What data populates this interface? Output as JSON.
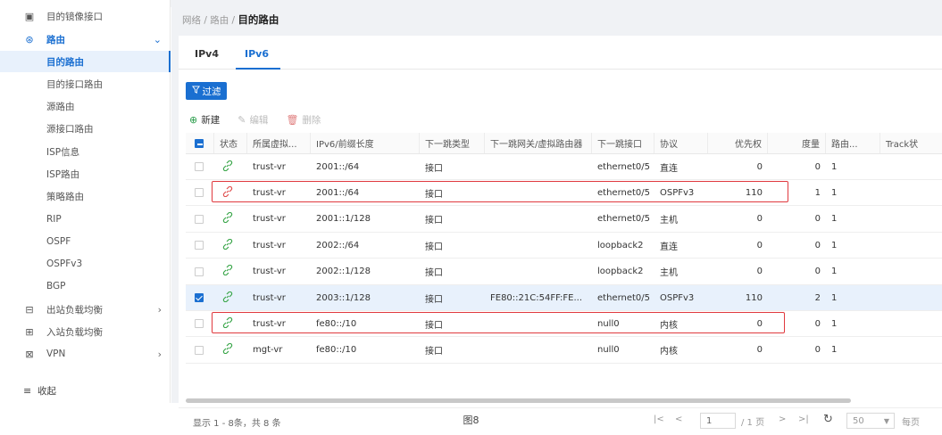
{
  "sidebar": {
    "items": [
      {
        "icon": "mirror-icon",
        "label": "目的镜像接口",
        "type": "top"
      },
      {
        "icon": "route-icon",
        "label": "路由",
        "type": "group",
        "arrow": "chevron-down-icon"
      },
      {
        "label": "目的路由",
        "type": "active"
      },
      {
        "label": "目的接口路由",
        "type": "sub"
      },
      {
        "label": "源路由",
        "type": "sub"
      },
      {
        "label": "源接口路由",
        "type": "sub"
      },
      {
        "label": "ISP信息",
        "type": "sub"
      },
      {
        "label": "ISP路由",
        "type": "sub"
      },
      {
        "label": "策略路由",
        "type": "sub"
      },
      {
        "label": "RIP",
        "type": "sub"
      },
      {
        "label": "OSPF",
        "type": "sub"
      },
      {
        "label": "OSPFv3",
        "type": "sub"
      },
      {
        "label": "BGP",
        "type": "sub"
      },
      {
        "icon": "outbound-lb-icon",
        "label": "出站负载均衡",
        "type": "top",
        "arrow": "chevron-right-icon"
      },
      {
        "icon": "inbound-lb-icon",
        "label": "入站负载均衡",
        "type": "top"
      },
      {
        "icon": "vpn-icon",
        "label": "VPN",
        "type": "top",
        "arrow": "chevron-right-icon"
      }
    ],
    "footer": {
      "icon": "collapse-icon",
      "label": "收起"
    }
  },
  "breadcrumb": {
    "part1": "网络 / 路由 / ",
    "current": "目的路由"
  },
  "tabs": [
    {
      "label": "IPv4",
      "active": false
    },
    {
      "label": "IPv6",
      "active": true
    }
  ],
  "filter_button": {
    "icon": "filter-icon",
    "label": "过滤"
  },
  "toolbar": {
    "add": {
      "icon": "plus-circle-icon",
      "label": "新建"
    },
    "edit": {
      "icon": "edit-icon",
      "label": "编辑"
    },
    "delete": {
      "icon": "trash-icon",
      "label": "删除"
    }
  },
  "table": {
    "columns": [
      "",
      "状态",
      "所属虚拟...",
      "IPv6/前缀长度",
      "下一跳类型",
      "下一跳网关/虚拟路由器",
      "下一跳接口",
      "协议",
      "优先权",
      "度量",
      "路由...",
      "Track状"
    ],
    "rows": [
      {
        "checked": false,
        "status": "ok",
        "vr": "trust-vr",
        "prefix": "2001::/64",
        "nh_type": "接口",
        "gateway": "",
        "iface": "ethernet0/5",
        "proto": "直连",
        "priority": "0",
        "metric": "0",
        "route": "1"
      },
      {
        "checked": false,
        "status": "bad",
        "vr": "trust-vr",
        "prefix": "2001::/64",
        "nh_type": "接口",
        "gateway": "",
        "iface": "ethernet0/5",
        "proto": "OSPFv3",
        "priority": "110",
        "metric": "1",
        "route": "1"
      },
      {
        "checked": false,
        "status": "ok",
        "vr": "trust-vr",
        "prefix": "2001::1/128",
        "nh_type": "接口",
        "gateway": "",
        "iface": "ethernet0/5",
        "proto": "主机",
        "priority": "0",
        "metric": "0",
        "route": "1"
      },
      {
        "checked": false,
        "status": "ok",
        "vr": "trust-vr",
        "prefix": "2002::/64",
        "nh_type": "接口",
        "gateway": "",
        "iface": "loopback2",
        "proto": "直连",
        "priority": "0",
        "metric": "0",
        "route": "1"
      },
      {
        "checked": false,
        "status": "ok",
        "vr": "trust-vr",
        "prefix": "2002::1/128",
        "nh_type": "接口",
        "gateway": "",
        "iface": "loopback2",
        "proto": "主机",
        "priority": "0",
        "metric": "0",
        "route": "1"
      },
      {
        "checked": true,
        "status": "ok",
        "vr": "trust-vr",
        "prefix": "2003::1/128",
        "nh_type": "接口",
        "gateway": "FE80::21C:54FF:FE...",
        "iface": "ethernet0/5",
        "proto": "OSPFv3",
        "priority": "110",
        "metric": "2",
        "route": "1"
      },
      {
        "checked": false,
        "status": "ok",
        "vr": "trust-vr",
        "prefix": "fe80::/10",
        "nh_type": "接口",
        "gateway": "",
        "iface": "null0",
        "proto": "内核",
        "priority": "0",
        "metric": "0",
        "route": "1"
      },
      {
        "checked": false,
        "status": "ok",
        "vr": "mgt-vr",
        "prefix": "fe80::/10",
        "nh_type": "接口",
        "gateway": "",
        "iface": "null0",
        "proto": "内核",
        "priority": "0",
        "metric": "0",
        "route": "1"
      }
    ]
  },
  "pager": {
    "info": "显示 1 - 8条，共 8 条",
    "first": "|<",
    "prev": "<",
    "page": "1",
    "total": "/ 1 页",
    "next": ">",
    "last": ">|",
    "refresh_icon": "refresh-icon",
    "size": "50",
    "per_page": "每页"
  },
  "caption": "图8",
  "colors": {
    "accent": "#1a6fd1",
    "ok": "#3aa64a",
    "bad": "#e05050",
    "highlight": "#e0393e"
  }
}
